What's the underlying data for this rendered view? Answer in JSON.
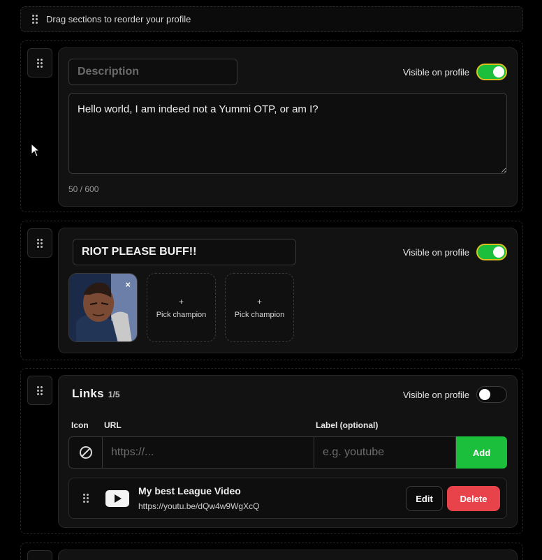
{
  "hint": {
    "text": "Drag sections to reorder your profile"
  },
  "description_section": {
    "title_placeholder": "Description",
    "visibility_label": "Visible on profile",
    "visible": true,
    "body": "Hello world, I am indeed not a Yummi OTP, or am I?",
    "counter": "50 / 600"
  },
  "champions_section": {
    "title": "RIOT PLEASE BUFF!!",
    "visibility_label": "Visible on profile",
    "visible": true,
    "remove_glyph": "×",
    "empty_slots": [
      {
        "plus": "+",
        "label": "Pick champion"
      },
      {
        "plus": "+",
        "label": "Pick champion"
      }
    ]
  },
  "links_section": {
    "title": "Links",
    "count": "1/5",
    "visibility_label": "Visible on profile",
    "visible": false,
    "columns": {
      "icon": "Icon",
      "url": "URL",
      "label": "Label (optional)"
    },
    "url_placeholder": "https://...",
    "label_placeholder": "e.g. youtube",
    "add_label": "Add",
    "items": [
      {
        "icon": "youtube-icon",
        "title": "My best League Video",
        "url": "https://youtu.be/dQw4w9WgXcQ",
        "edit_label": "Edit",
        "delete_label": "Delete"
      }
    ]
  },
  "colors": {
    "accent_green": "#1bbf3b",
    "toggle_outline": "#d7c020",
    "danger": "#e8434a"
  }
}
